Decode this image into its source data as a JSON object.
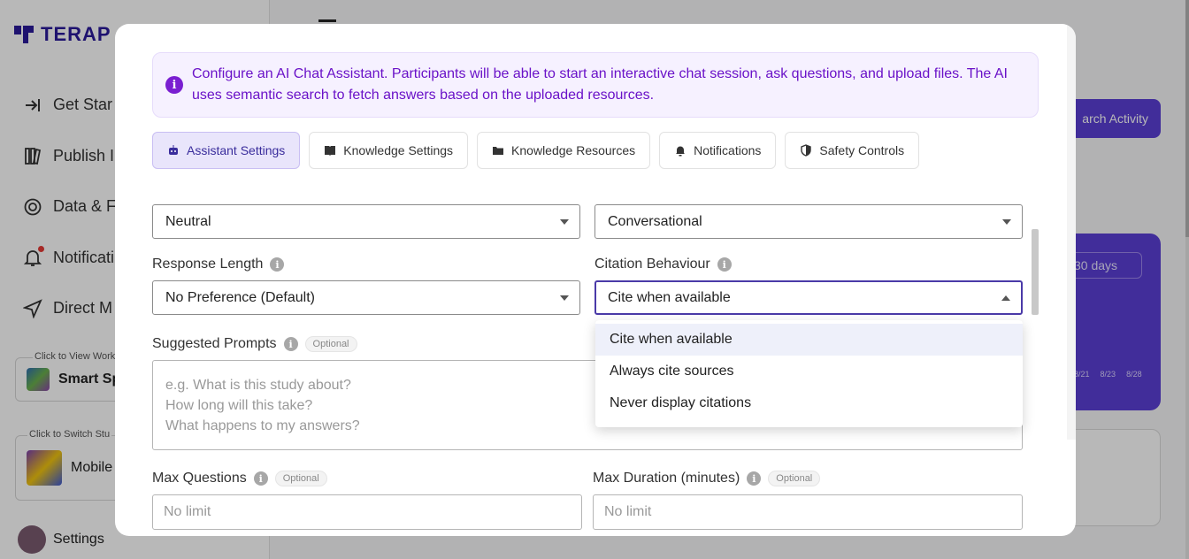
{
  "background": {
    "logo_text": "TERAP",
    "nav": [
      {
        "label": "Get Star",
        "icon": "enter-arrow-icon"
      },
      {
        "label": "Publish I",
        "icon": "library-icon"
      },
      {
        "label": "Data & F",
        "icon": "chart-ring-icon"
      },
      {
        "label": "Notificati",
        "icon": "bell-icon"
      },
      {
        "label": "Direct M",
        "icon": "send-icon"
      }
    ],
    "workspace_label": "Click to View Works",
    "workspace_name": "Smart Sp",
    "study_label": "Click to Switch Stu",
    "study_name": "Mobile",
    "settings_label": "Settings",
    "search_button": "arch Activity",
    "range_select": "30 days",
    "ticks": [
      "8/21",
      "8/23",
      "8/28"
    ]
  },
  "modal": {
    "info": "Configure an AI Chat Assistant. Participants will be able to start an interactive chat session, ask questions, and upload files. The AI uses semantic search to fetch answers based on the uploaded resources.",
    "tabs": [
      {
        "label": "Assistant Settings",
        "icon": "robot-icon",
        "active": true
      },
      {
        "label": "Knowledge Settings",
        "icon": "book-icon",
        "active": false
      },
      {
        "label": "Knowledge Resources",
        "icon": "folder-icon",
        "active": false
      },
      {
        "label": "Notifications",
        "icon": "bell-icon",
        "active": false
      },
      {
        "label": "Safety Controls",
        "icon": "shield-icon",
        "active": false
      }
    ],
    "tone_select": "Neutral",
    "style_select": "Conversational",
    "response_length_label": "Response Length",
    "response_length_value": "No Preference (Default)",
    "citation_label": "Citation Behaviour",
    "citation_value": "Cite when available",
    "citation_options": [
      "Cite when available",
      "Always cite sources",
      "Never display citations"
    ],
    "suggested_prompts_label": "Suggested Prompts",
    "optional_badge": "Optional",
    "suggested_prompts_placeholder": [
      "e.g. What is this study about?",
      "How long will this take?",
      "What happens to my answers?"
    ],
    "max_questions_label": "Max Questions",
    "max_questions_placeholder": "No limit",
    "max_duration_label": "Max Duration (minutes)",
    "max_duration_placeholder": "No limit"
  },
  "colors": {
    "accent": "#4a3aa8",
    "info_text": "#6a12c8",
    "info_bg": "#f6f1ff",
    "brand": "#5b3fd6"
  }
}
